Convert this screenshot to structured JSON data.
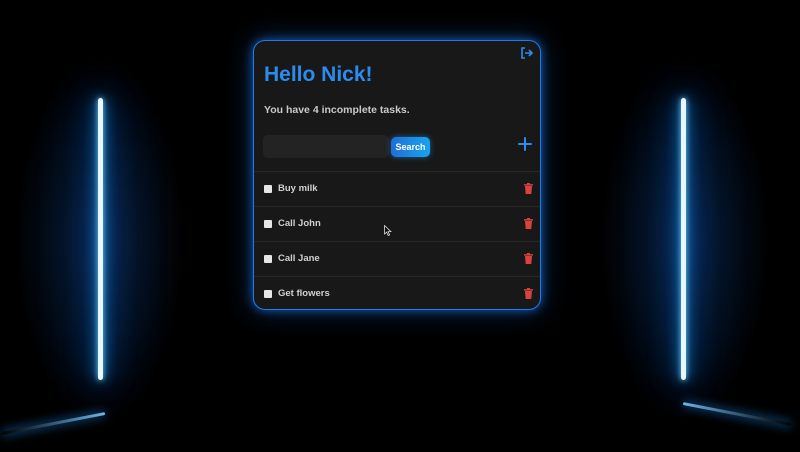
{
  "header": {
    "greeting": "Hello Nick!",
    "task_summary": "You have 4 incomplete tasks."
  },
  "search": {
    "placeholder": "",
    "value": "",
    "button_label": "Search"
  },
  "tasks": [
    {
      "label": "Buy milk",
      "checked": false
    },
    {
      "label": "Call John",
      "checked": false
    },
    {
      "label": "Call Jane",
      "checked": false
    },
    {
      "label": "Get flowers",
      "checked": false
    }
  ],
  "icons": {
    "logout": "logout-icon",
    "add": "plus-icon",
    "delete": "trash-icon"
  },
  "colors": {
    "accent": "#1d7bf0",
    "title": "#2a8cf0",
    "delete": "#d9433f",
    "card_bg": "#181818",
    "page_bg": "#000000"
  }
}
